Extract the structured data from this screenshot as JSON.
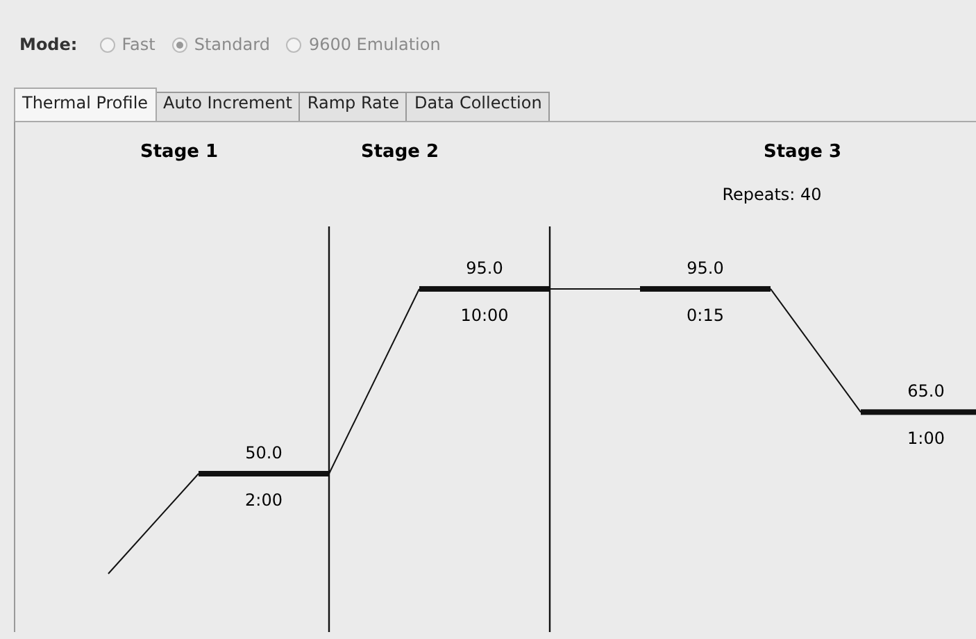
{
  "mode": {
    "label": "Mode:",
    "disabled": true,
    "options": [
      {
        "label": "Fast",
        "selected": false
      },
      {
        "label": "Standard",
        "selected": true
      },
      {
        "label": "9600 Emulation",
        "selected": false
      }
    ]
  },
  "tabs": [
    {
      "label": "Thermal Profile",
      "selected": true
    },
    {
      "label": "Auto Increment",
      "selected": false
    },
    {
      "label": "Ramp Rate",
      "selected": false
    },
    {
      "label": "Data Collection",
      "selected": false
    }
  ],
  "stages": [
    {
      "title": "Stage 1",
      "steps": [
        {
          "temperature": "50.0",
          "time": "2:00"
        }
      ]
    },
    {
      "title": "Stage 2",
      "steps": [
        {
          "temperature": "95.0",
          "time": "10:00"
        }
      ]
    },
    {
      "title": "Stage 3",
      "repeats": "Repeats: 40",
      "steps": [
        {
          "temperature": "95.0",
          "time": "0:15"
        },
        {
          "temperature": "65.0",
          "time": "1:00"
        }
      ]
    }
  ]
}
